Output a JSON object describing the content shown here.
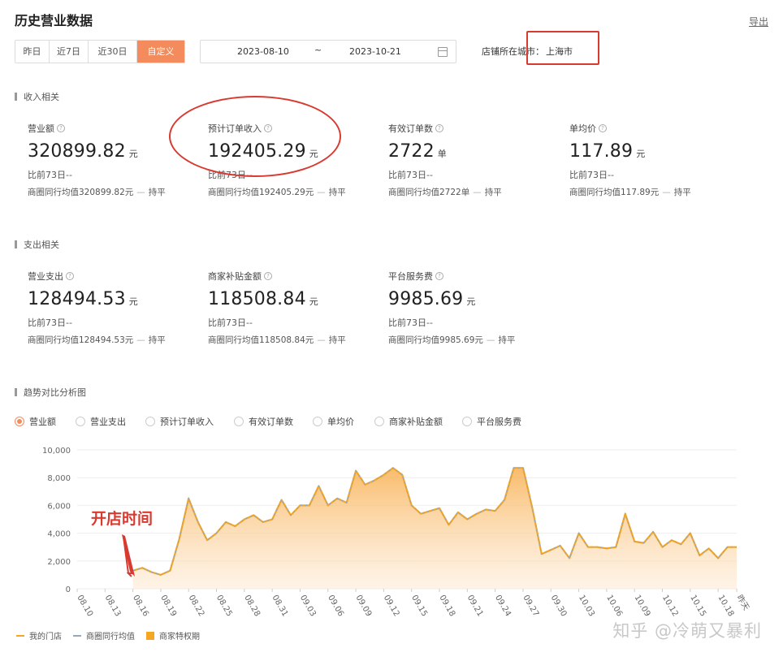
{
  "header": {
    "title": "历史营业数据",
    "export_label": "导出"
  },
  "range_tabs": [
    {
      "label": "昨日",
      "active": false
    },
    {
      "label": "近7日",
      "active": false
    },
    {
      "label": "近30日",
      "active": false
    },
    {
      "label": "自定义",
      "active": true
    }
  ],
  "date_range": {
    "start": "2023-08-10",
    "separator": "~",
    "end": "2023-10-21"
  },
  "city": {
    "label": "店铺所在城市：",
    "value": "上海市"
  },
  "income_section": {
    "title": "收入相关",
    "metrics": [
      {
        "label": "营业额",
        "value": "320899.82",
        "unit": "元",
        "compare": "比前73日--",
        "avg": "商圈同行均值320899.82元",
        "trend": "持平"
      },
      {
        "label": "预计订单收入",
        "value": "192405.29",
        "unit": "元",
        "compare": "比前73日--",
        "avg": "商圈同行均值192405.29元",
        "trend": "持平"
      },
      {
        "label": "有效订单数",
        "value": "2722",
        "unit": "单",
        "compare": "比前73日--",
        "avg": "商圈同行均值2722单",
        "trend": "持平"
      },
      {
        "label": "单均价",
        "value": "117.89",
        "unit": "元",
        "compare": "比前73日--",
        "avg": "商圈同行均值117.89元",
        "trend": "持平"
      }
    ]
  },
  "expense_section": {
    "title": "支出相关",
    "metrics": [
      {
        "label": "营业支出",
        "value": "128494.53",
        "unit": "元",
        "compare": "比前73日--",
        "avg": "商圈同行均值128494.53元",
        "trend": "持平"
      },
      {
        "label": "商家补贴金额",
        "value": "118508.84",
        "unit": "元",
        "compare": "比前73日--",
        "avg": "商圈同行均值118508.84元",
        "trend": "持平"
      },
      {
        "label": "平台服务费",
        "value": "9985.69",
        "unit": "元",
        "compare": "比前73日--",
        "avg": "商圈同行均值9985.69元",
        "trend": "持平"
      }
    ]
  },
  "trend_section": {
    "title": "趋势对比分析图",
    "options": [
      {
        "label": "营业额",
        "selected": true
      },
      {
        "label": "营业支出",
        "selected": false
      },
      {
        "label": "预计订单收入",
        "selected": false
      },
      {
        "label": "有效订单数",
        "selected": false
      },
      {
        "label": "单均价",
        "selected": false
      },
      {
        "label": "商家补贴金额",
        "selected": false
      },
      {
        "label": "平台服务费",
        "selected": false
      }
    ]
  },
  "legend": {
    "mine": "我的门店",
    "peer": "商圈同行均值",
    "privilege": "商家特权期"
  },
  "annotation": {
    "text": "开店时间"
  },
  "watermark": "知乎 @冷萌又暴利",
  "colors": {
    "accent": "#f48b5c",
    "line": "#f5a623",
    "peer_line": "#9aa7b5",
    "highlight": "#d93a30"
  },
  "chart_data": {
    "type": "area",
    "x_tick_labels": [
      "08.10",
      "08.13",
      "08.16",
      "08.19",
      "08.22",
      "08.25",
      "08.28",
      "08.31",
      "09.03",
      "09.06",
      "09.09",
      "09.12",
      "09.15",
      "09.18",
      "09.21",
      "09.24",
      "09.27",
      "09.30",
      "10.03",
      "10.06",
      "10.09",
      "10.12",
      "10.15",
      "10.18",
      "昨天"
    ],
    "y_tick_labels": [
      "0",
      "2,000",
      "4,000",
      "6,000",
      "8,000",
      "10,000"
    ],
    "ylim": [
      0,
      10000
    ],
    "grid": true,
    "series": [
      {
        "name": "我的门店",
        "x": [
          "08.16",
          "08.17",
          "08.18",
          "08.19",
          "08.20",
          "08.21",
          "08.22",
          "08.23",
          "08.24",
          "08.25",
          "08.26",
          "08.27",
          "08.28",
          "08.29",
          "08.30",
          "08.31",
          "09.01",
          "09.02",
          "09.03",
          "09.04",
          "09.05",
          "09.06",
          "09.07",
          "09.08",
          "09.09",
          "09.10",
          "09.11",
          "09.12",
          "09.13",
          "09.14",
          "09.15",
          "09.16",
          "09.17",
          "09.18",
          "09.19",
          "09.20",
          "09.21",
          "09.22",
          "09.23",
          "09.24",
          "09.25",
          "09.26",
          "09.27",
          "09.28",
          "09.29",
          "09.30",
          "10.01",
          "10.02",
          "10.03",
          "10.04",
          "10.05",
          "10.06",
          "10.07",
          "10.08",
          "10.09",
          "10.10",
          "10.11",
          "10.12",
          "10.13",
          "10.14",
          "10.15",
          "10.16",
          "10.17",
          "10.18",
          "10.19",
          "10.20"
        ],
        "values": [
          1300,
          1500,
          1200,
          1000,
          1300,
          3600,
          6500,
          4800,
          3500,
          4000,
          4800,
          4500,
          5000,
          5300,
          4800,
          5000,
          6400,
          5300,
          6000,
          6000,
          7400,
          6000,
          6500,
          6200,
          8500,
          7500,
          7800,
          8200,
          8700,
          8200,
          6000,
          5400,
          5600,
          5800,
          4600,
          5500,
          5000,
          5400,
          5700,
          5600,
          6400,
          8700,
          8700,
          5800,
          2500,
          2800,
          3100,
          2200,
          4000,
          3000,
          3000,
          2900,
          3000,
          5400,
          3400,
          3300,
          4100,
          3000,
          3500,
          3200,
          4000,
          2400,
          2900,
          2200,
          3000,
          3000
        ]
      },
      {
        "name": "商圈同行均值",
        "x": [
          "08.16",
          "08.17",
          "08.18",
          "08.19",
          "08.20",
          "08.21",
          "08.22",
          "08.23",
          "08.24",
          "08.25",
          "08.26",
          "08.27",
          "08.28",
          "08.29",
          "08.30",
          "08.31",
          "09.01",
          "09.02",
          "09.03",
          "09.04",
          "09.05",
          "09.06",
          "09.07",
          "09.08",
          "09.09",
          "09.10",
          "09.11",
          "09.12",
          "09.13",
          "09.14",
          "09.15",
          "09.16",
          "09.17",
          "09.18",
          "09.19",
          "09.20",
          "09.21",
          "09.22",
          "09.23",
          "09.24",
          "09.25",
          "09.26",
          "09.27",
          "09.28",
          "09.29",
          "09.30",
          "10.01",
          "10.02",
          "10.03",
          "10.04",
          "10.05",
          "10.06",
          "10.07",
          "10.08",
          "10.09",
          "10.10",
          "10.11",
          "10.12",
          "10.13",
          "10.14",
          "10.15",
          "10.16",
          "10.17",
          "10.18",
          "10.19",
          "10.20"
        ],
        "values": [
          1300,
          1500,
          1200,
          1000,
          1300,
          3600,
          6500,
          4800,
          3500,
          4000,
          4800,
          4500,
          5000,
          5300,
          4800,
          5000,
          6400,
          5300,
          6000,
          6000,
          7400,
          6000,
          6500,
          6200,
          8500,
          7500,
          7800,
          8200,
          8700,
          8200,
          6000,
          5400,
          5600,
          5800,
          4600,
          5500,
          5000,
          5400,
          5700,
          5600,
          6400,
          8700,
          8700,
          5800,
          2500,
          2800,
          3100,
          2200,
          4000,
          3000,
          3000,
          2900,
          3000,
          5400,
          3400,
          3300,
          4100,
          3000,
          3500,
          3200,
          4000,
          2400,
          2900,
          2200,
          3000,
          3000
        ]
      }
    ]
  }
}
